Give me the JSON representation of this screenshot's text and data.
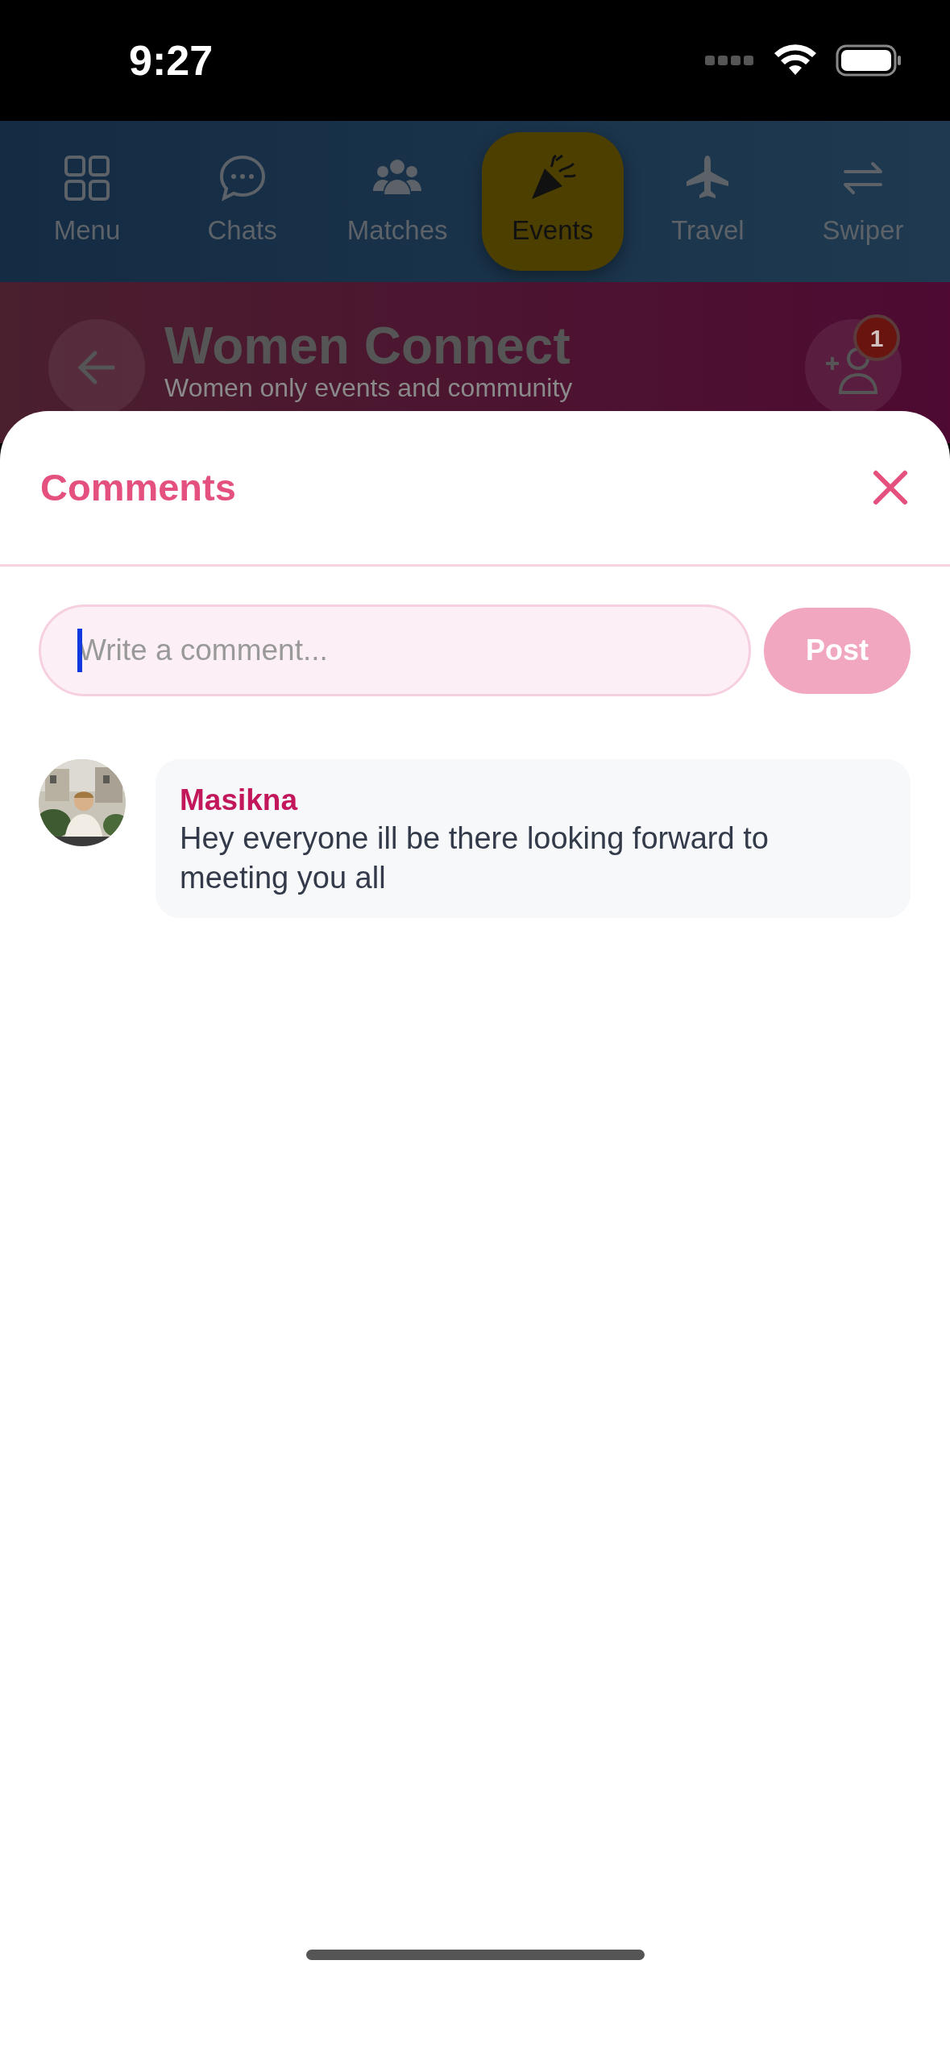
{
  "status_bar": {
    "time": "9:27"
  },
  "nav": {
    "tabs": [
      {
        "label": "Menu",
        "kind": "grid",
        "selected": false
      },
      {
        "label": "Chats",
        "kind": "chat",
        "selected": false
      },
      {
        "label": "Matches",
        "kind": "people",
        "selected": false
      },
      {
        "label": "Events",
        "kind": "party",
        "selected": true
      },
      {
        "label": "Travel",
        "kind": "plane",
        "selected": false
      },
      {
        "label": "Swiper",
        "kind": "swap",
        "selected": false
      }
    ]
  },
  "header": {
    "title": "Women Connect",
    "subtitle": "Women only events and community",
    "badge": "1"
  },
  "sheet": {
    "title": "Comments",
    "input": {
      "placeholder": "Write a comment...",
      "focused": true
    },
    "post_button": "Post",
    "comments": [
      {
        "author": "Masikna",
        "text": "Hey everyone ill be there looking forward to meeting you all"
      }
    ]
  }
}
